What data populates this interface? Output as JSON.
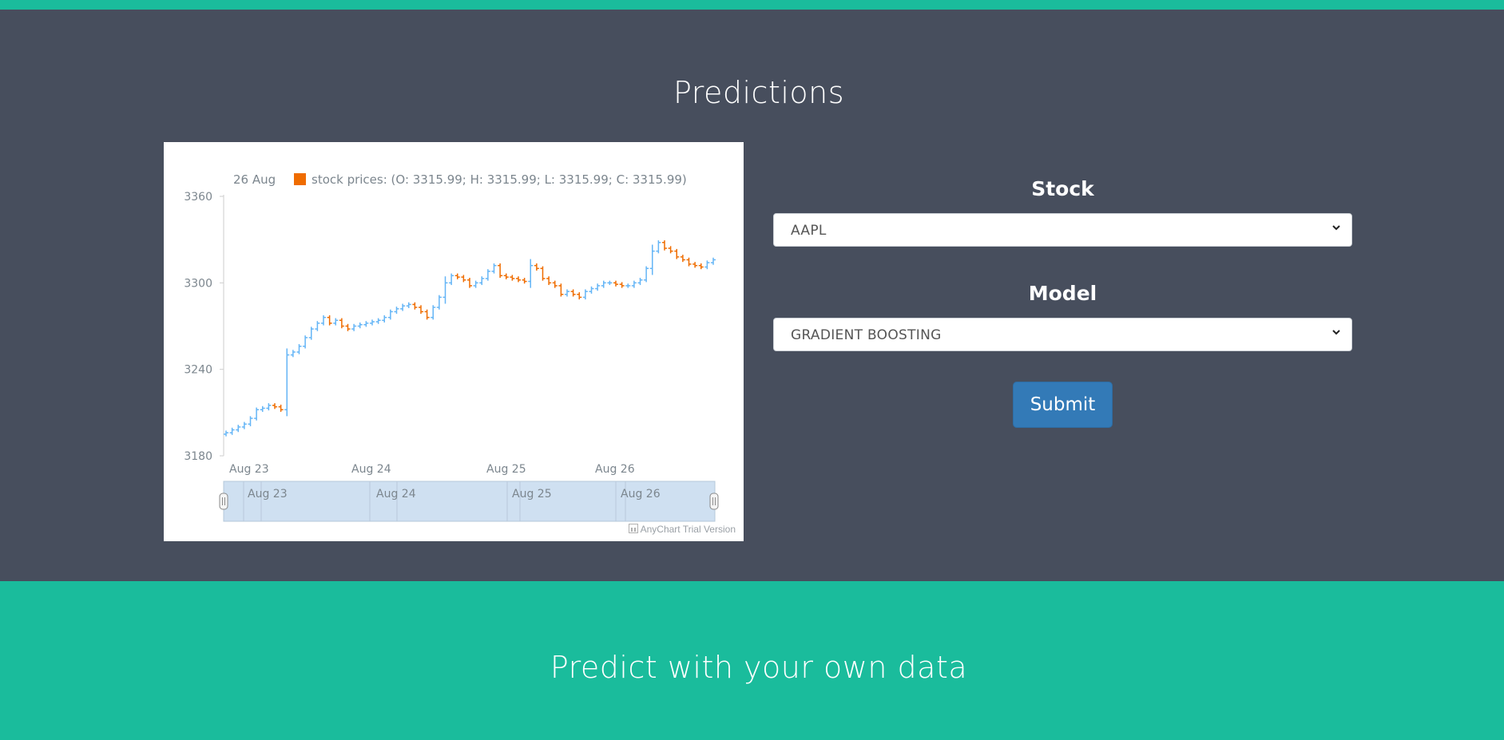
{
  "page": {
    "title": "Predictions",
    "footer_title": "Predict with your own data"
  },
  "form": {
    "stock_label": "Stock",
    "stock_value": "AAPL",
    "model_label": "Model",
    "model_value": "GRADIENT BOOSTING",
    "submit_label": "Submit"
  },
  "colors": {
    "background": "#474e5d",
    "accent": "#1abc9c",
    "rising": "#64b5f6",
    "falling": "#ef6c00",
    "button": "#337ab7"
  },
  "chart": {
    "legend_date": "26 Aug",
    "legend_text": "stock prices: (O: 3315.99; H: 3315.99; L: 3315.99; C: 3315.99)",
    "credits": "AnyChart Trial Version"
  },
  "chart_data": {
    "type": "ohlc",
    "title": "",
    "series": [
      {
        "name": "stock prices"
      }
    ],
    "ylim": [
      3180,
      3360
    ],
    "yticks": [
      3180,
      3240,
      3300,
      3360
    ],
    "xticks": [
      "Aug 23",
      "Aug 24",
      "Aug 25",
      "Aug 26"
    ],
    "scroller_labels": [
      "Aug 23",
      "Aug 24",
      "Aug 25",
      "Aug 26"
    ],
    "close_path": [
      3196,
      3198,
      3200,
      3202,
      3206,
      3212,
      3213,
      3215,
      3214,
      3212,
      3250,
      3252,
      3256,
      3262,
      3268,
      3272,
      3276,
      3272,
      3274,
      3270,
      3268,
      3270,
      3271,
      3272,
      3273,
      3274,
      3276,
      3280,
      3282,
      3284,
      3285,
      3283,
      3280,
      3276,
      3283,
      3290,
      3300,
      3305,
      3304,
      3302,
      3298,
      3300,
      3303,
      3308,
      3312,
      3305,
      3304,
      3303,
      3302,
      3301,
      3312,
      3310,
      3303,
      3300,
      3298,
      3292,
      3294,
      3292,
      3290,
      3294,
      3296,
      3298,
      3300,
      3300,
      3299,
      3298,
      3298,
      3300,
      3302,
      3310,
      3322,
      3328,
      3324,
      3322,
      3318,
      3316,
      3313,
      3312,
      3311,
      3314,
      3315.99
    ]
  }
}
